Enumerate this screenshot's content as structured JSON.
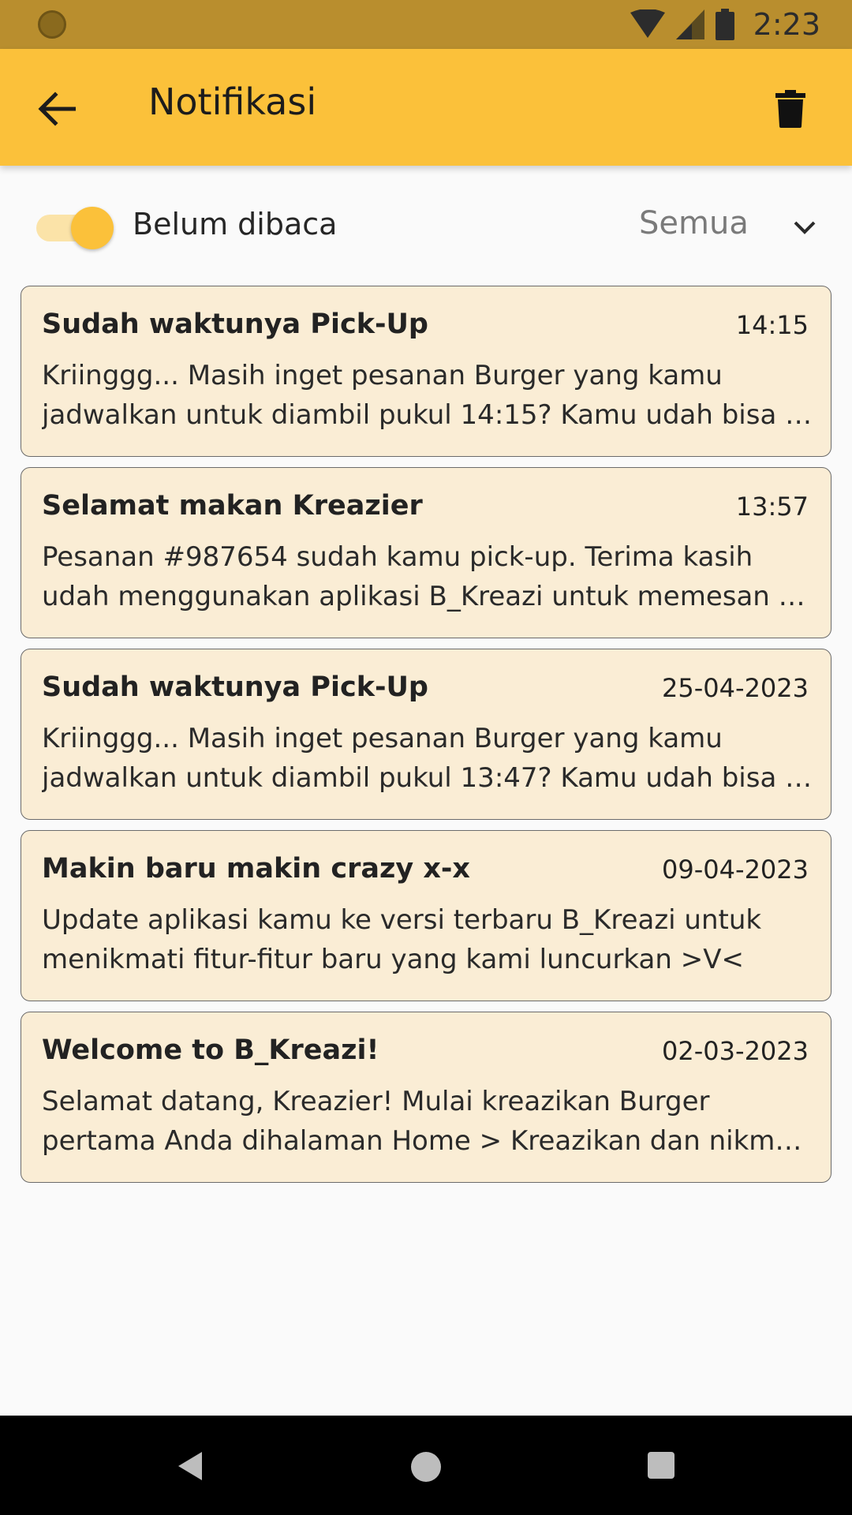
{
  "status_bar": {
    "time": "2:23",
    "icons": [
      "notification-dot-icon",
      "wifi-icon",
      "signal-icon",
      "battery-icon"
    ]
  },
  "app_bar": {
    "title": "Notifikasi",
    "back_icon": "arrow-back-icon",
    "delete_icon": "trash-icon"
  },
  "filter": {
    "toggle_label": "Belum dibaca",
    "toggle_on": true,
    "dropdown_value": "Semua"
  },
  "notifications": [
    {
      "title": "Sudah waktunya Pick-Up",
      "time": "14:15",
      "body": "Kriinggg... Masih inget pesanan Burger yang kamu jadwalkan untuk diambil pukul 14:15? Kamu udah bisa …"
    },
    {
      "title": "Selamat makan Kreazier",
      "time": "13:57",
      "body": "Pesanan #987654 sudah kamu pick-up. Terima kasih udah menggunakan aplikasi B_Kreazi untuk memesan …"
    },
    {
      "title": "Sudah waktunya Pick-Up",
      "time": "25-04-2023",
      "body": "Kriinggg... Masih inget pesanan Burger yang kamu jadwalkan untuk diambil pukul 13:47? Kamu udah bisa …"
    },
    {
      "title": "Makin baru makin crazy x-x",
      "time": "09-04-2023",
      "body": "Update aplikasi kamu ke versi terbaru B_Kreazi untuk menikmati fitur-fitur baru yang kami luncurkan >V<"
    },
    {
      "title": "Welcome to B_Kreazi!",
      "time": "02-03-2023",
      "body": "Selamat datang, Kreazier! Mulai kreazikan Burger pertama Anda dihalaman Home > Kreazikan dan nikm…"
    }
  ],
  "colors": {
    "status_bar": "#b98e2e",
    "app_bar": "#fbc13a",
    "card_bg": "#faedd5",
    "background": "#fafafa"
  }
}
